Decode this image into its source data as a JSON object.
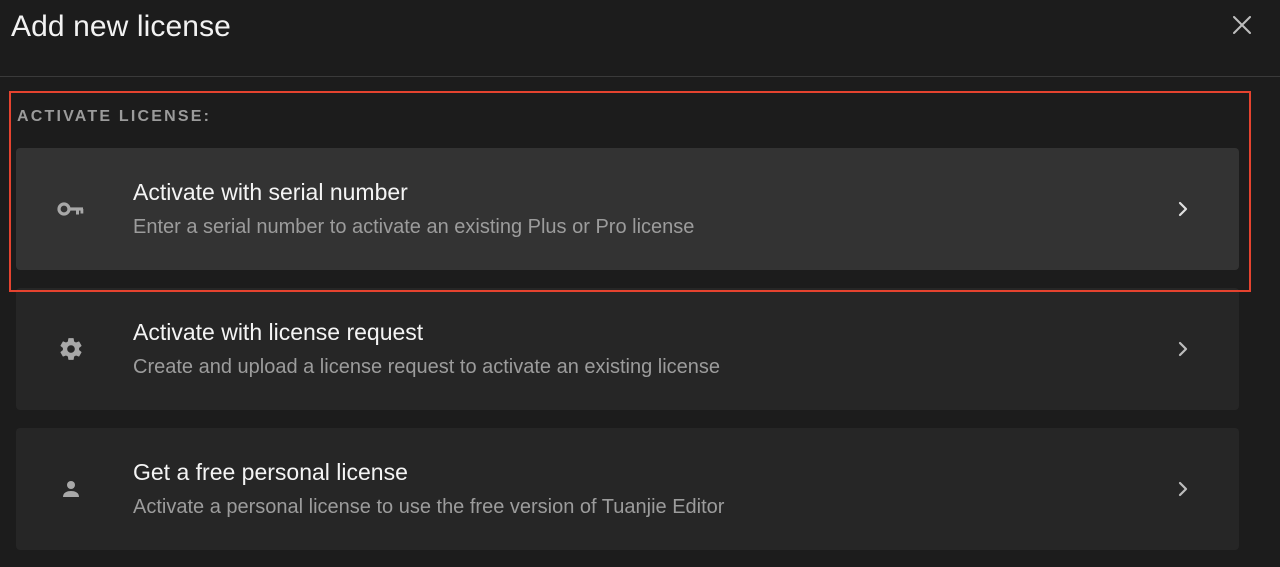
{
  "dialog": {
    "title": "Add new license",
    "close_icon": "close-icon"
  },
  "section": {
    "label": "ACTIVATE LICENSE:"
  },
  "options": [
    {
      "title": "Activate with serial number",
      "description": "Enter a serial number to activate an existing Plus or Pro license",
      "icon": "key-icon",
      "highlighted": true
    },
    {
      "title": "Activate with license request",
      "description": "Create and upload a license request to activate an existing license",
      "icon": "gear-icon",
      "highlighted": false
    },
    {
      "title": "Get a free personal license",
      "description": "Activate a personal license to use the free version of Tuanjie Editor",
      "icon": "person-icon",
      "highlighted": false
    }
  ],
  "colors": {
    "background": "#1c1c1c",
    "card_selected": "#333333",
    "card": "#262626",
    "highlight_border": "#e5432f",
    "text_primary": "#f4f4f4",
    "text_secondary": "#9c9c9c",
    "section_label": "#9b9b9b"
  }
}
